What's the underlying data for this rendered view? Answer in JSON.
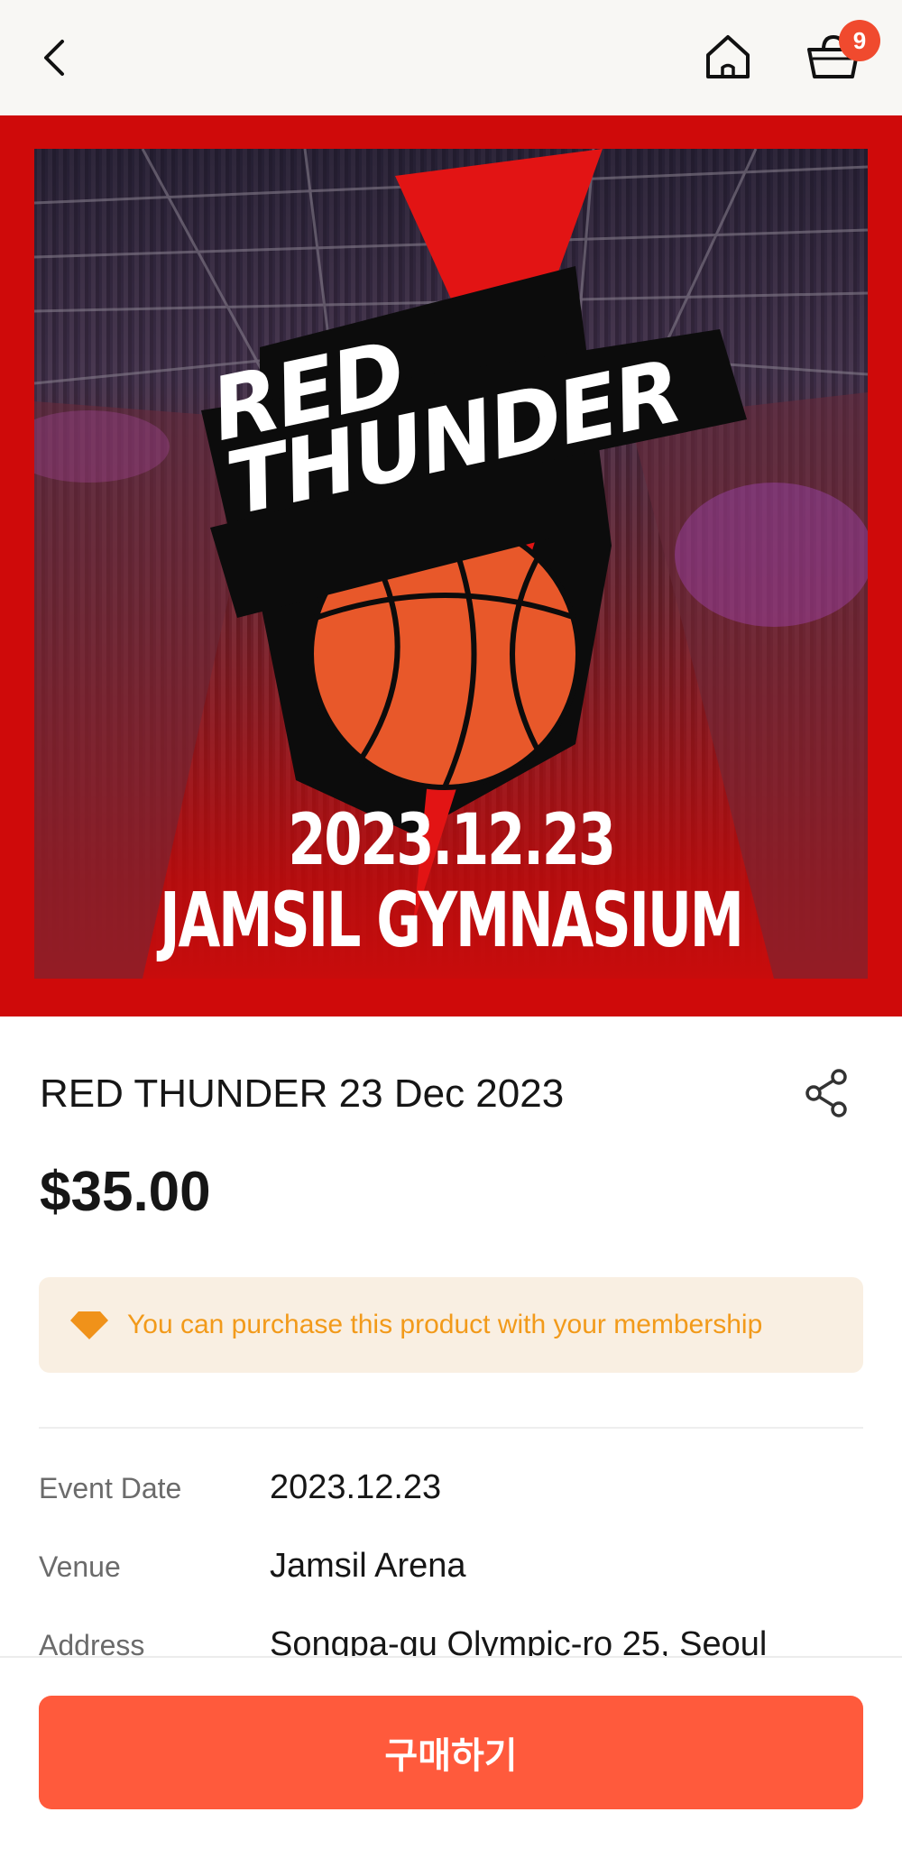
{
  "header": {
    "back_icon": "chevron-left-icon",
    "home_icon": "home-icon",
    "cart_icon": "basket-icon",
    "cart_count": "9"
  },
  "poster": {
    "team_line1": "RED",
    "team_line2": "THUNDER",
    "date": "2023.12.23",
    "venue": "JAMSIL GYMNASIUM"
  },
  "product": {
    "title": "RED THUNDER 23 Dec 2023",
    "price": "$35.00",
    "share_icon": "share-icon"
  },
  "membership_notice": {
    "icon": "diamond-icon",
    "text": "You can purchase this product with your membership"
  },
  "details": [
    {
      "label": "Event Date",
      "value": "2023.12.23"
    },
    {
      "label": "Venue",
      "value": "Jamsil Arena"
    },
    {
      "label": "Address",
      "value": "Songpa-gu Olympic-ro 25, Seoul"
    }
  ],
  "footer": {
    "buy_label": "구매하기"
  },
  "colors": {
    "accent": "#ff5a3c",
    "hero_red": "#cf0a0a",
    "notice_bg": "#f9efe2",
    "notice_text": "#f29a1a",
    "badge": "#f04a2e"
  }
}
